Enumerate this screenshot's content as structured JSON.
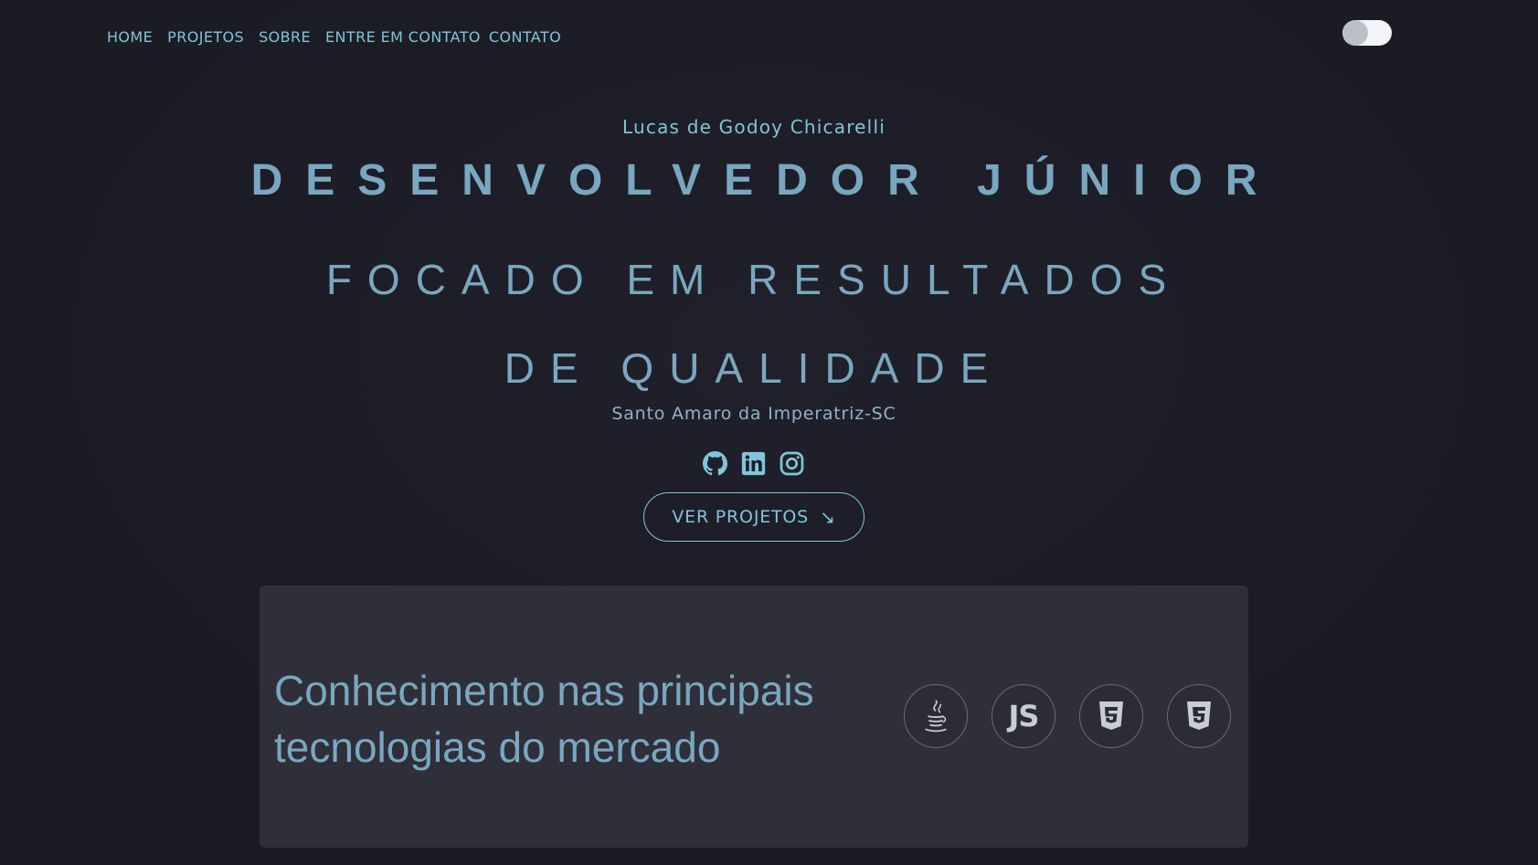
{
  "nav": {
    "items": [
      {
        "label": "HOME"
      },
      {
        "label": "PROJETOS"
      },
      {
        "label": "SOBRE"
      },
      {
        "label": "ENTRE EM CONTATO"
      },
      {
        "label": "CONTATO"
      }
    ]
  },
  "theme_toggle": {
    "state": "off"
  },
  "hero": {
    "name": "Lucas de Godoy Chicarelli",
    "title": "DESENVOLVEDOR JÚNIOR",
    "subtitle": "FOCADO EM RESULTADOS DE QUALIDADE",
    "location": "Santo Amaro da Imperatriz-SC",
    "socials": [
      {
        "icon": "github-icon"
      },
      {
        "icon": "linkedin-icon"
      },
      {
        "icon": "instagram-icon"
      }
    ],
    "cta_label": "VER PROJETOS",
    "cta_arrow": "↘"
  },
  "skills_card": {
    "text": "Conhecimento nas principais tecnologias do mercado",
    "technologies": [
      {
        "icon": "java-icon"
      },
      {
        "icon": "javascript-icon",
        "label": "JS"
      },
      {
        "icon": "html5-icon"
      },
      {
        "icon": "css3-icon"
      }
    ]
  },
  "colors": {
    "background": "#1c1c27",
    "accent": "#7fc6d8",
    "heading": "#7aa7c0",
    "card": "#2f2f3a"
  }
}
